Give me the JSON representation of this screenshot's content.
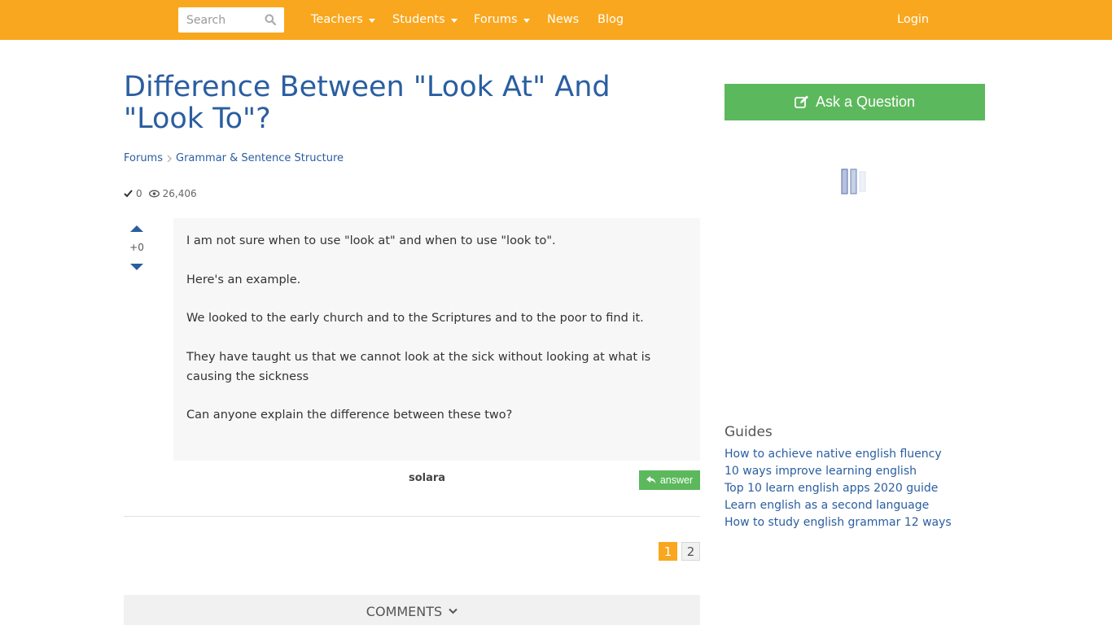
{
  "header": {
    "search_placeholder": "Search",
    "nav": [
      {
        "label": "Teachers",
        "has_dropdown": true
      },
      {
        "label": "Students",
        "has_dropdown": true
      },
      {
        "label": "Forums",
        "has_dropdown": true
      },
      {
        "label": "News",
        "has_dropdown": false
      },
      {
        "label": "Blog",
        "has_dropdown": false
      }
    ],
    "login_label": "Login",
    "bar_color": "#f9a71e"
  },
  "question": {
    "title": "Difference Between \"Look At\" And \"Look To\"?",
    "breadcrumb": [
      "Forums",
      "Grammar & Sentence Structure"
    ],
    "answers_count": "0",
    "views_count": "26,406",
    "vote_score": "+0",
    "paragraphs": [
      "I am not sure when to use \"look at\" and when to use \"look to\".",
      "Here's an example.",
      "We looked to the early church and to the Scriptures and to the poor to find it.",
      "They have taught us that we cannot look at the sick without looking at what is causing the sickness",
      "Can anyone explain the difference between these two?"
    ],
    "author": "solara",
    "answer_label": "answer"
  },
  "pagination": {
    "pages": [
      "1",
      "2"
    ],
    "current": "1"
  },
  "comments_label": "COMMENTS",
  "sidebar": {
    "ask_label": "Ask a Question",
    "guides_title": "Guides",
    "guides": [
      "How to achieve native english fluency",
      "10 ways improve learning english",
      "Top 10 learn english apps 2020 guide",
      "Learn english as a second language",
      "How to study english grammar 12 ways"
    ]
  },
  "colors": {
    "accent": "#f9a71e",
    "link": "#2a5ea0",
    "success": "#5cb85c"
  }
}
